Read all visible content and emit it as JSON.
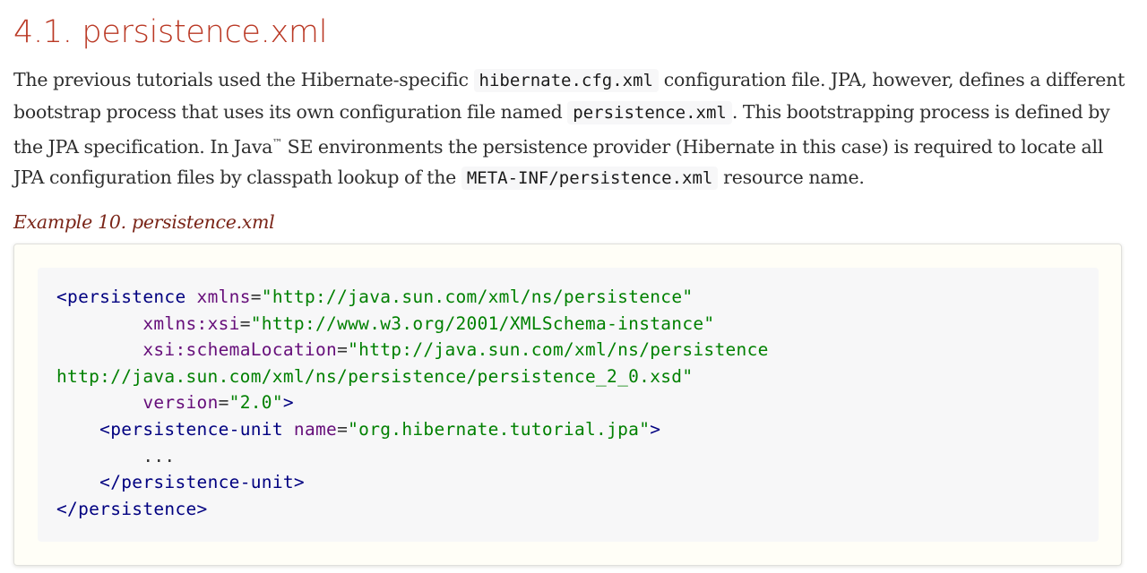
{
  "section": {
    "title": "4.1. persistence.xml"
  },
  "paragraph": {
    "t1": "The previous tutorials used the Hibernate-specific",
    "c1": "hibernate.cfg.xml",
    "t2": "configuration file. JPA, however, defines a different bootstrap process that uses its own configuration file named",
    "c2": "persistence.xml",
    "t3": ". This bootstrapping process is defined by the JPA specification. In Java",
    "tm": "™",
    "t4": " SE environments the persistence provider (Hibernate in this case) is required to locate all JPA configuration files by classpath lookup of the",
    "c3": "META-INF/persistence.xml",
    "t5": "resource name."
  },
  "example": {
    "title": "Example 10. persistence.xml",
    "code": {
      "l1": {
        "lt": "<",
        "tag": "persistence",
        "sp": " ",
        "attr": "xmlns",
        "eq": "=",
        "val": "\"http://java.sun.com/xml/ns/persistence\""
      },
      "l2": {
        "indent": "        ",
        "attr": "xmlns:xsi",
        "eq": "=",
        "val": "\"http://www.w3.org/2001/XMLSchema-instance\""
      },
      "l3": {
        "indent": "        ",
        "attr": "xsi:schemaLocation",
        "eq": "=",
        "val": "\"http://java.sun.com/xml/ns/persistence"
      },
      "l4": {
        "val": "http://java.sun.com/xml/ns/persistence/persistence_2_0.xsd\""
      },
      "l5": {
        "indent": "        ",
        "attr": "version",
        "eq": "=",
        "val": "\"2.0\"",
        "gt": ">"
      },
      "l6": {
        "indent": "    ",
        "lt": "<",
        "tag": "persistence-unit",
        "sp": " ",
        "attr": "name",
        "eq": "=",
        "val": "\"org.hibernate.tutorial.jpa\"",
        "gt": ">"
      },
      "l7": {
        "text": "        ..."
      },
      "l8": {
        "indent": "    ",
        "open": "</",
        "tag": "persistence-unit",
        "gt": ">"
      },
      "l9": {
        "open": "</",
        "tag": "persistence",
        "gt": ">"
      }
    }
  },
  "colors": {
    "heading": "#ba3925",
    "example_title": "#7a2518",
    "xml_tag": "#000080",
    "xml_attr": "#660e7a",
    "xml_value": "#008000",
    "code_background": "#f7f7f8",
    "example_background": "#fffef7"
  }
}
